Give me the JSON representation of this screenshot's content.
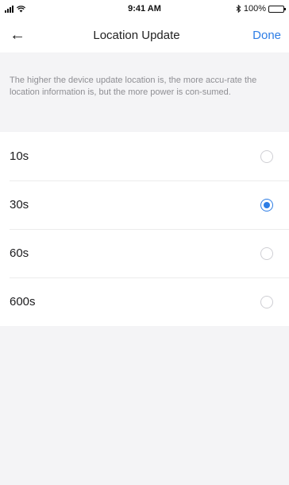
{
  "status_bar": {
    "time": "9:41 AM",
    "battery": "100%",
    "bluetooth_icon": "bluetooth-icon",
    "signal_icon": "signal-icon",
    "wifi_icon": "wifi-icon"
  },
  "nav": {
    "back_icon": "arrow-left-icon",
    "back_glyph": "←",
    "title": "Location Update",
    "done_label": "Done"
  },
  "description": "The higher the device update location is, the more accu-rate the location information is, but the more power is con-sumed.",
  "options": [
    {
      "label": "10s",
      "selected": false
    },
    {
      "label": "30s",
      "selected": true
    },
    {
      "label": "60s",
      "selected": false
    },
    {
      "label": "600s",
      "selected": false
    }
  ],
  "colors": {
    "accent": "#2d7de5",
    "background": "#f4f4f6",
    "description_text": "#8e8e93"
  }
}
